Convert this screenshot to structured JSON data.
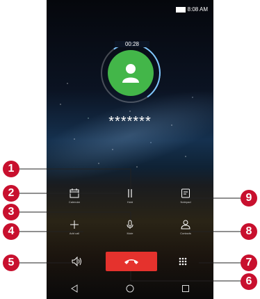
{
  "status_bar": {
    "time": "8:08 AM"
  },
  "call": {
    "timer": "00:28",
    "number": "*******"
  },
  "controls": {
    "hold": "Hold",
    "calendar": "Calendar",
    "notepad": "Notepad",
    "add_call": "Add call",
    "mute": "Mute",
    "contacts": "Contacts"
  },
  "callouts": [
    "1",
    "2",
    "3",
    "4",
    "5",
    "6",
    "7",
    "8",
    "9"
  ],
  "colors": {
    "end_call": "#e5322d",
    "avatar": "#43b649",
    "callout": "#c8102e"
  }
}
